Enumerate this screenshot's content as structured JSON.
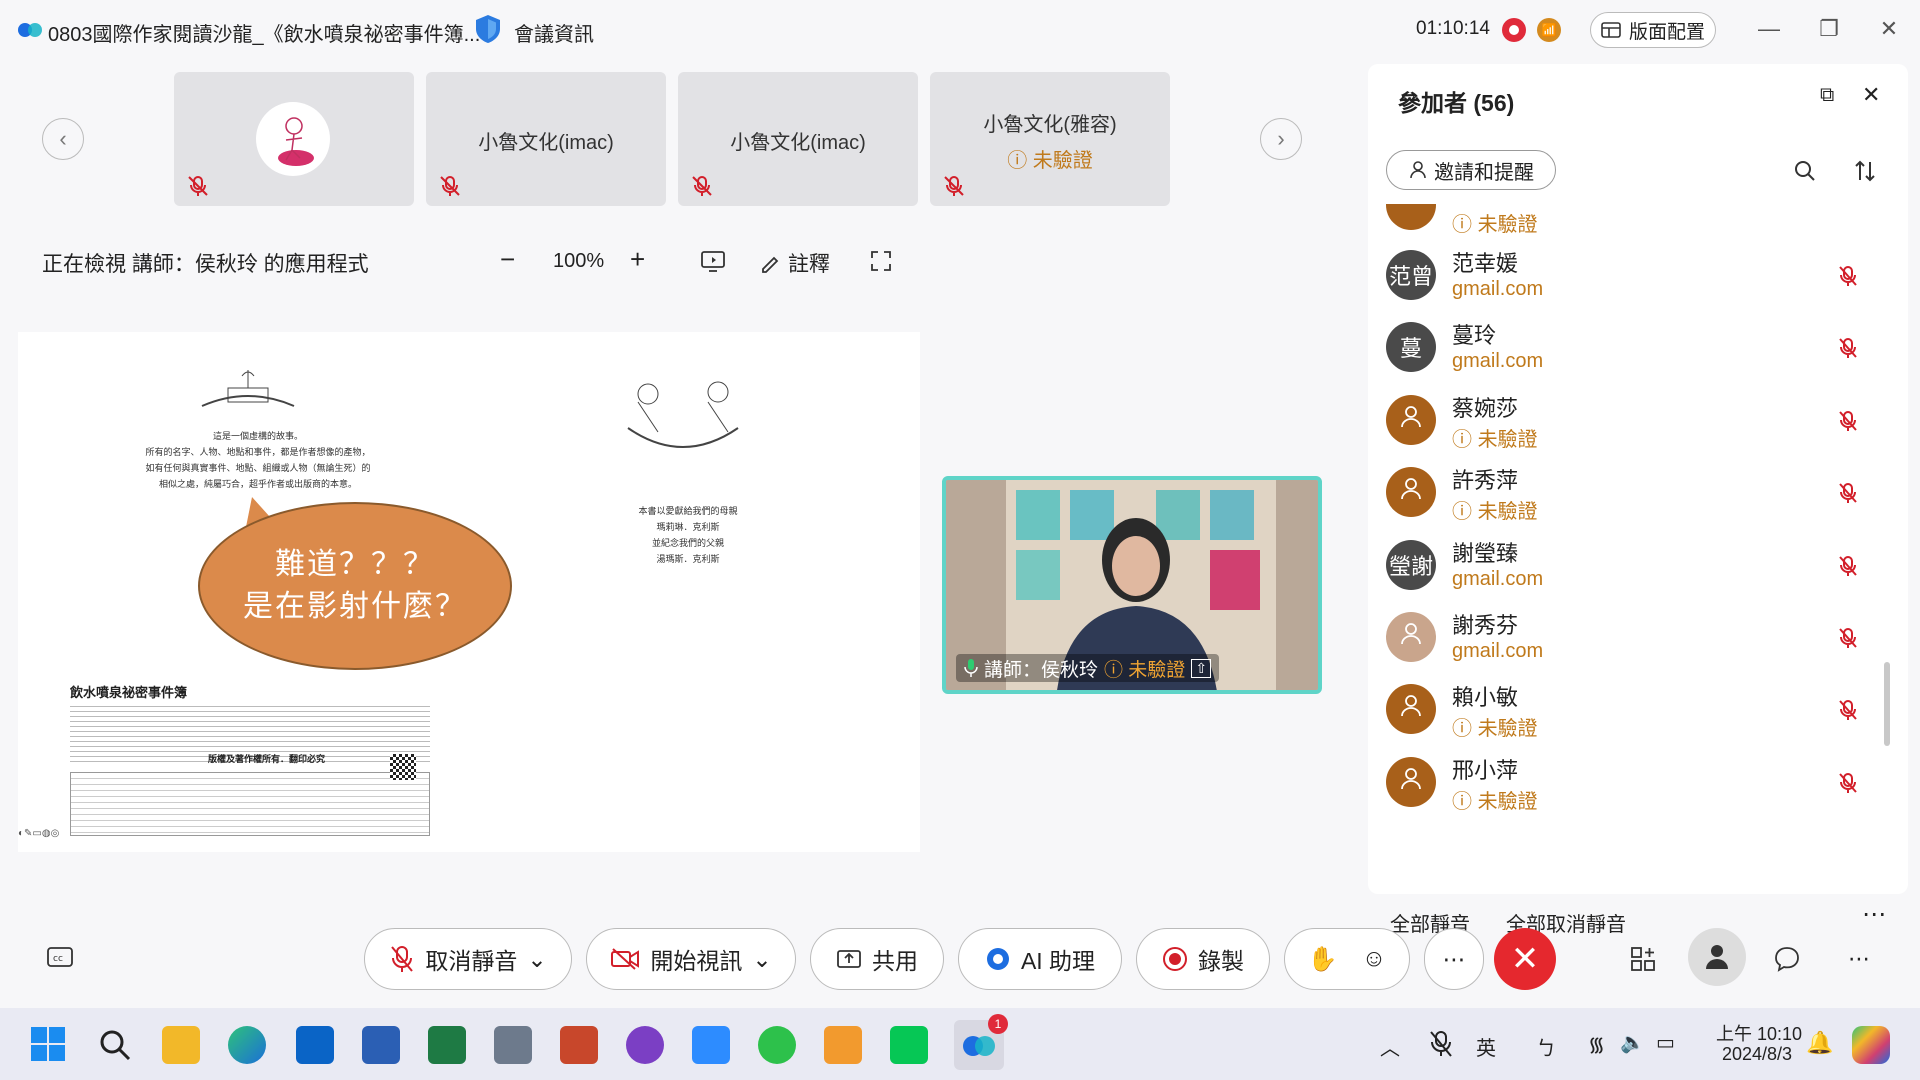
{
  "titlebar": {
    "title": "0803國際作家閱讀沙龍_《飲水噴泉祕密事件簿...",
    "meeting_info": "會議資訊",
    "timer": "01:10:14",
    "layout_button": "版面配置"
  },
  "thumbnails": [
    {
      "name": ""
    },
    {
      "name": "小魯文化(imac)"
    },
    {
      "name": "小魯文化(imac)"
    },
    {
      "name": "小魯文化(雅容)",
      "status": "未驗證"
    }
  ],
  "share_toolbar": {
    "viewing": "正在檢視 講師：侯秋玲 的應用程式",
    "zoom": "100%",
    "annotate": "註釋"
  },
  "document": {
    "bubble_line1": "難道？？？",
    "bubble_line2": "是在影射什麼？",
    "story_lines": [
      "這是一個虛構的故事。",
      "所有的名字、人物、地點和事件，都是作者想像的產物，",
      "如有任何與真實事件、地點、組織或人物（無論生死）的",
      "相似之處，純屬巧合，超乎作者或出版商的本意。"
    ],
    "dedication_lines": [
      "本書以愛獻給我們的母親",
      "瑪莉琳．克利斯",
      "並紀念我們的父親",
      "湯瑪斯．克利斯"
    ],
    "book_title": "飲水噴泉祕密事件簿",
    "copyright_head": "版權及著作權所有．翻印必究"
  },
  "video": {
    "caption": "講師：侯秋玲",
    "status": "未驗證"
  },
  "participants": {
    "title": "參加者 (56)",
    "invite": "邀請和提醒",
    "partial_row_status": "未驗證",
    "items": [
      {
        "name": "范幸媛",
        "sub": "gmail.com",
        "avatar_text": "范曾",
        "avatar_color": "#4a4a4a",
        "sub_type": "email"
      },
      {
        "name": "蔓玲",
        "sub": "gmail.com",
        "avatar_text": "蔓",
        "avatar_color": "#4a4a4a",
        "sub_type": "email"
      },
      {
        "name": "蔡婉莎",
        "sub": "未驗證",
        "avatar_text": "",
        "avatar_color": "#a8601a",
        "sub_type": "unverified"
      },
      {
        "name": "許秀萍",
        "sub": "未驗證",
        "avatar_text": "",
        "avatar_color": "#a8601a",
        "sub_type": "unverified"
      },
      {
        "name": "謝瑩臻",
        "sub": "gmail.com",
        "avatar_text": "瑩謝",
        "avatar_color": "#4a4a4a",
        "sub_type": "email"
      },
      {
        "name": "謝秀芬",
        "sub": "gmail.com",
        "avatar_text": "",
        "avatar_color": "#c9a58c",
        "sub_type": "email"
      },
      {
        "name": "賴小敏",
        "sub": "未驗證",
        "avatar_text": "",
        "avatar_color": "#a8601a",
        "sub_type": "unverified"
      },
      {
        "name": "邢小萍",
        "sub": "未驗證",
        "avatar_text": "",
        "avatar_color": "#a8601a",
        "sub_type": "unverified"
      }
    ],
    "mute_all": "全部靜音",
    "unmute_all": "全部取消靜音"
  },
  "controls": {
    "unmute": "取消靜音",
    "start_video": "開始視訊",
    "share": "共用",
    "ai": "AI 助理",
    "record": "錄製"
  },
  "taskbar": {
    "ime1": "英",
    "ime2": "ㄅ",
    "time": "上午 10:10",
    "date": "2024/8/3",
    "badge": "1"
  },
  "colors": {
    "accent": "#e5282e",
    "unverified": "#c07a1c",
    "email": "#c07a1c",
    "video_border": "#5fd4c8"
  }
}
